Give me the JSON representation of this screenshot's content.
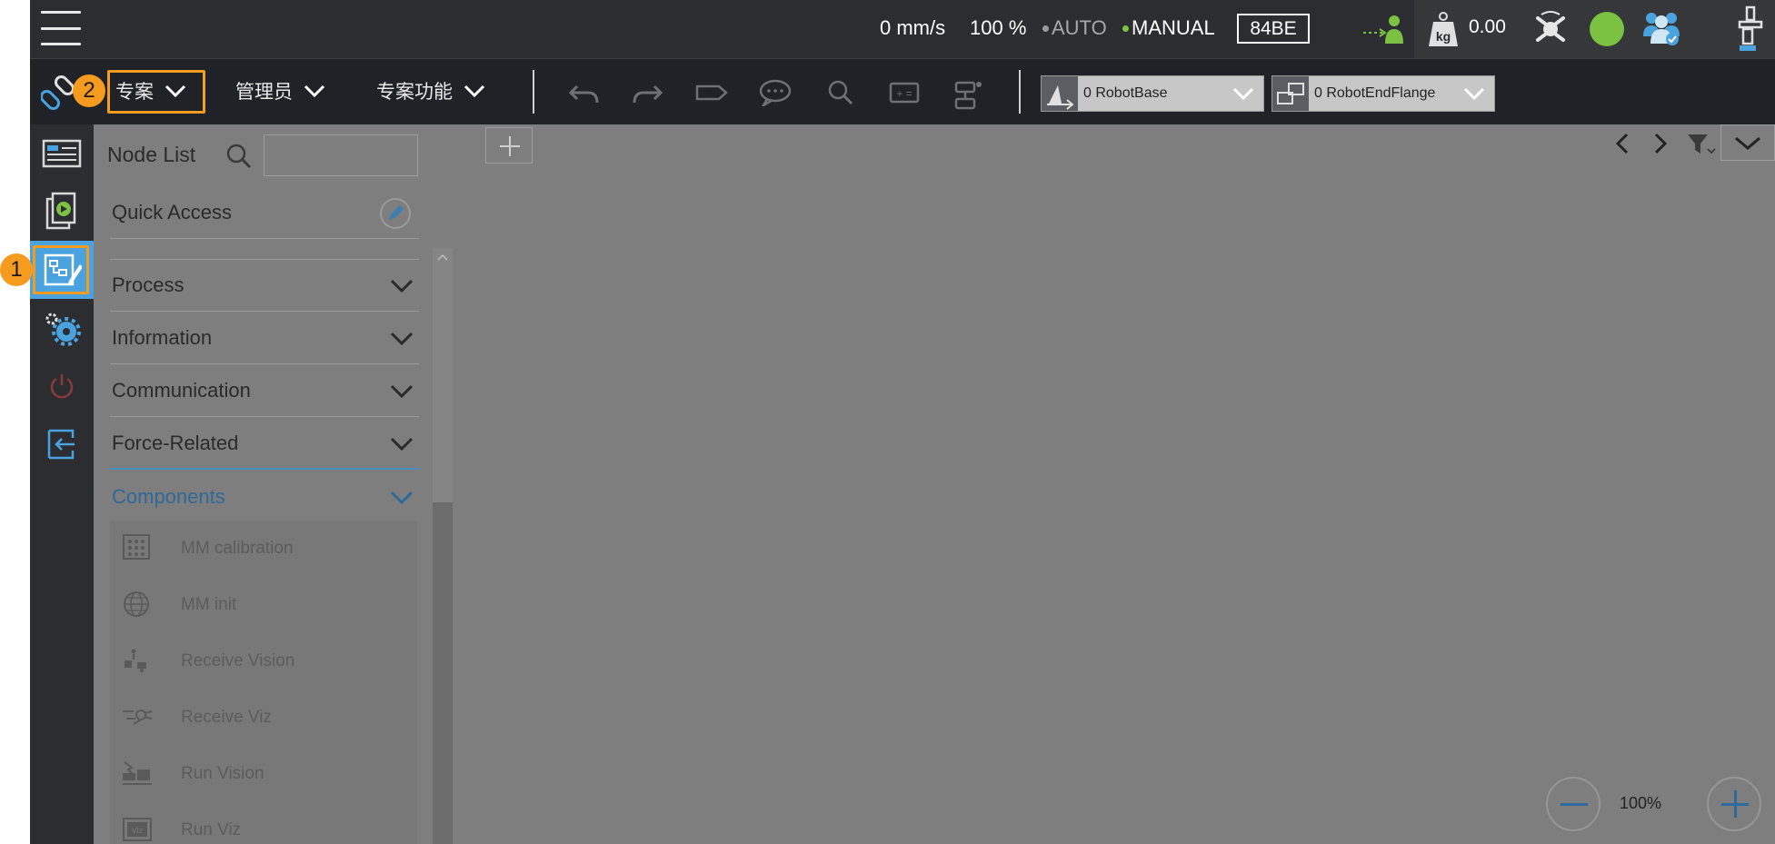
{
  "status": {
    "speed": "0 mm/s",
    "override": "100 %",
    "auto_label": "AUTO",
    "manual_label": "MANUAL",
    "robot_id": "84BE",
    "payload": "0.00",
    "payload_unit": "kg",
    "colors": {
      "auto_dot": "#9a9a9a",
      "manual_dot": "#7cc242",
      "status_ok": "#7cc242"
    }
  },
  "toolbar": {
    "menus": [
      {
        "label": "专案"
      },
      {
        "label": "管理员"
      },
      {
        "label": "专案功能"
      }
    ],
    "base_frame": "0 RobotBase",
    "tool_frame": "0 RobotEndFlange",
    "icons": [
      "undo-icon",
      "redo-icon",
      "tag-icon",
      "comment-icon",
      "search-icon",
      "variable-icon",
      "io-icon"
    ]
  },
  "node_panel": {
    "title": "Node List",
    "search_placeholder": "",
    "quick_access": "Quick Access",
    "categories": [
      {
        "label": "Process"
      },
      {
        "label": "Information"
      },
      {
        "label": "Communication"
      },
      {
        "label": "Force-Related"
      }
    ],
    "active_category": "Components",
    "components": [
      {
        "label": "MM calibration",
        "icon": "calibration-grid-icon"
      },
      {
        "label": "MM init",
        "icon": "globe-icon"
      },
      {
        "label": "Receive Vision",
        "icon": "receive-vision-icon"
      },
      {
        "label": "Receive Viz",
        "icon": "receive-viz-icon"
      },
      {
        "label": "Run Vision",
        "icon": "run-vision-icon"
      },
      {
        "label": "Run Viz",
        "icon": "run-viz-icon"
      }
    ]
  },
  "canvas": {
    "zoom": "100%"
  },
  "annotations": {
    "badge_1": "1",
    "badge_2": "2"
  },
  "accent_color": "#4aa3df",
  "highlight_color": "#f59b1f"
}
